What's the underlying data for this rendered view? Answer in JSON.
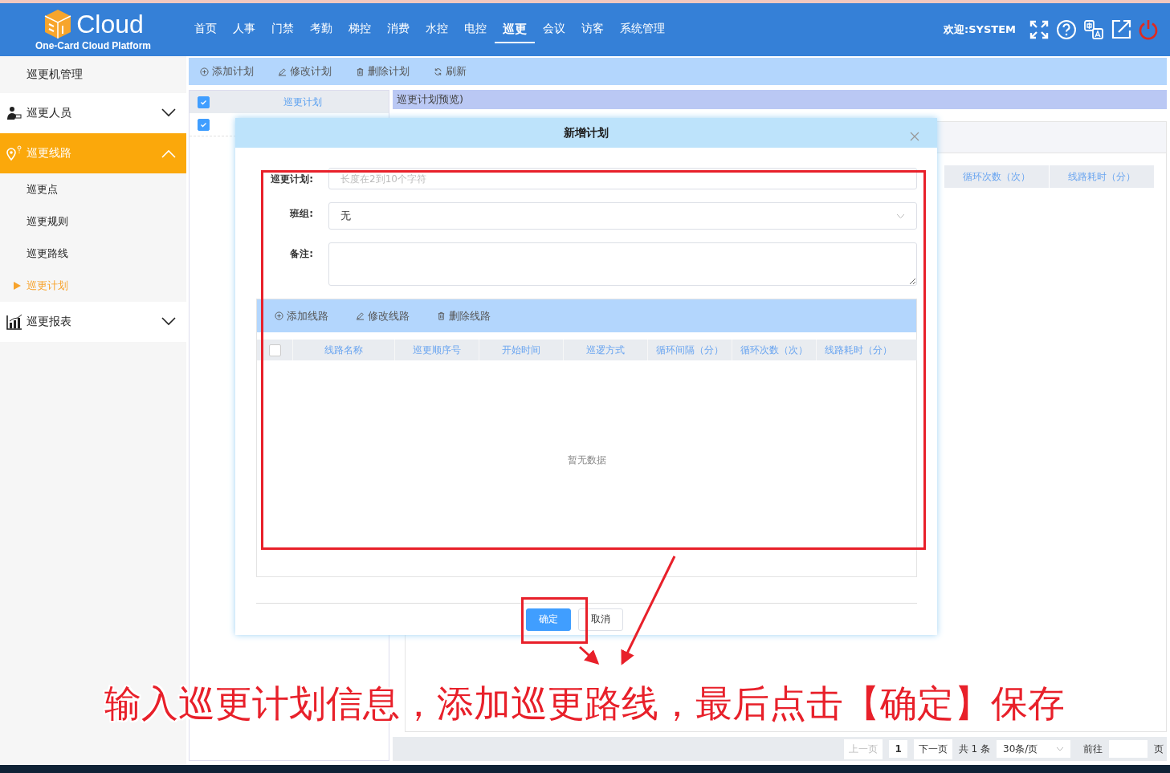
{
  "header": {
    "logo_text": "Cloud",
    "logo_subtitle": "One-Card Cloud Platform",
    "welcome": "欢迎:SYSTEM",
    "nav": [
      {
        "label": "首页",
        "selected": false
      },
      {
        "label": "人事",
        "selected": false
      },
      {
        "label": "门禁",
        "selected": false
      },
      {
        "label": "考勤",
        "selected": false
      },
      {
        "label": "梯控",
        "selected": false
      },
      {
        "label": "消费",
        "selected": false
      },
      {
        "label": "水控",
        "selected": false
      },
      {
        "label": "电控",
        "selected": false
      },
      {
        "label": "巡更",
        "selected": true
      },
      {
        "label": "会议",
        "selected": false
      },
      {
        "label": "访客",
        "selected": false
      },
      {
        "label": "系统管理",
        "selected": false
      }
    ]
  },
  "sidebar": {
    "items": [
      {
        "label": "巡更机管理",
        "kind": "item"
      },
      {
        "label": "巡更人员",
        "kind": "group",
        "expanded": false,
        "selected": false
      },
      {
        "label": "巡更线路",
        "kind": "group",
        "expanded": true,
        "selected": true,
        "children": [
          {
            "label": "巡更点",
            "selected": false
          },
          {
            "label": "巡更规则",
            "selected": false
          },
          {
            "label": "巡更路线",
            "selected": false
          },
          {
            "label": "巡更计划",
            "selected": true
          }
        ]
      },
      {
        "label": "巡更报表",
        "kind": "group",
        "expanded": false,
        "selected": false
      }
    ]
  },
  "toolbar": [
    {
      "label": "添加计划",
      "kind": "add"
    },
    {
      "label": "修改计划",
      "kind": "edit"
    },
    {
      "label": "删除计划",
      "kind": "delete"
    },
    {
      "label": "刷新",
      "kind": "refresh"
    }
  ],
  "plan_table": {
    "header": {
      "label": "巡更计划",
      "checked": true
    },
    "rows": [
      {
        "checked": true
      }
    ]
  },
  "preview": {
    "title": "巡更计划预览)",
    "columns": [
      "循环次数（次）",
      "线路耗时（分）"
    ]
  },
  "pagination": {
    "prev": {
      "label": "上一页",
      "disabled": true
    },
    "page": "1",
    "next": {
      "label": "下一页",
      "disabled": false
    },
    "total": "共 1 条",
    "page_size": "30条/页",
    "goto": "前往",
    "page_unit": "页"
  },
  "dialog": {
    "title": "新增计划",
    "fields": [
      {
        "label": "巡更计划:",
        "kind": "text",
        "placeholder": "长度在2到10个字符"
      },
      {
        "label": "班组:",
        "kind": "select",
        "value": "无"
      },
      {
        "label": "备注:",
        "kind": "textarea"
      }
    ],
    "toolbar": [
      {
        "label": "添加线路",
        "kind": "add"
      },
      {
        "label": "修改线路",
        "kind": "edit"
      },
      {
        "label": "删除线路",
        "kind": "delete"
      }
    ],
    "table": {
      "checked": false,
      "columns": [
        "线路名称",
        "巡更顺序号",
        "开始时间",
        "巡逻方式",
        "循环间隔（分）",
        "循环次数（次）",
        "线路耗时（分）"
      ],
      "empty": "暂无数据"
    },
    "buttons": [
      {
        "label": "确定",
        "kind": "primary"
      },
      {
        "label": "取消",
        "kind": "default"
      }
    ]
  },
  "annotation": {
    "caption": "输入巡更计划信息，添加巡更路线，最后点击【确定】保存"
  }
}
